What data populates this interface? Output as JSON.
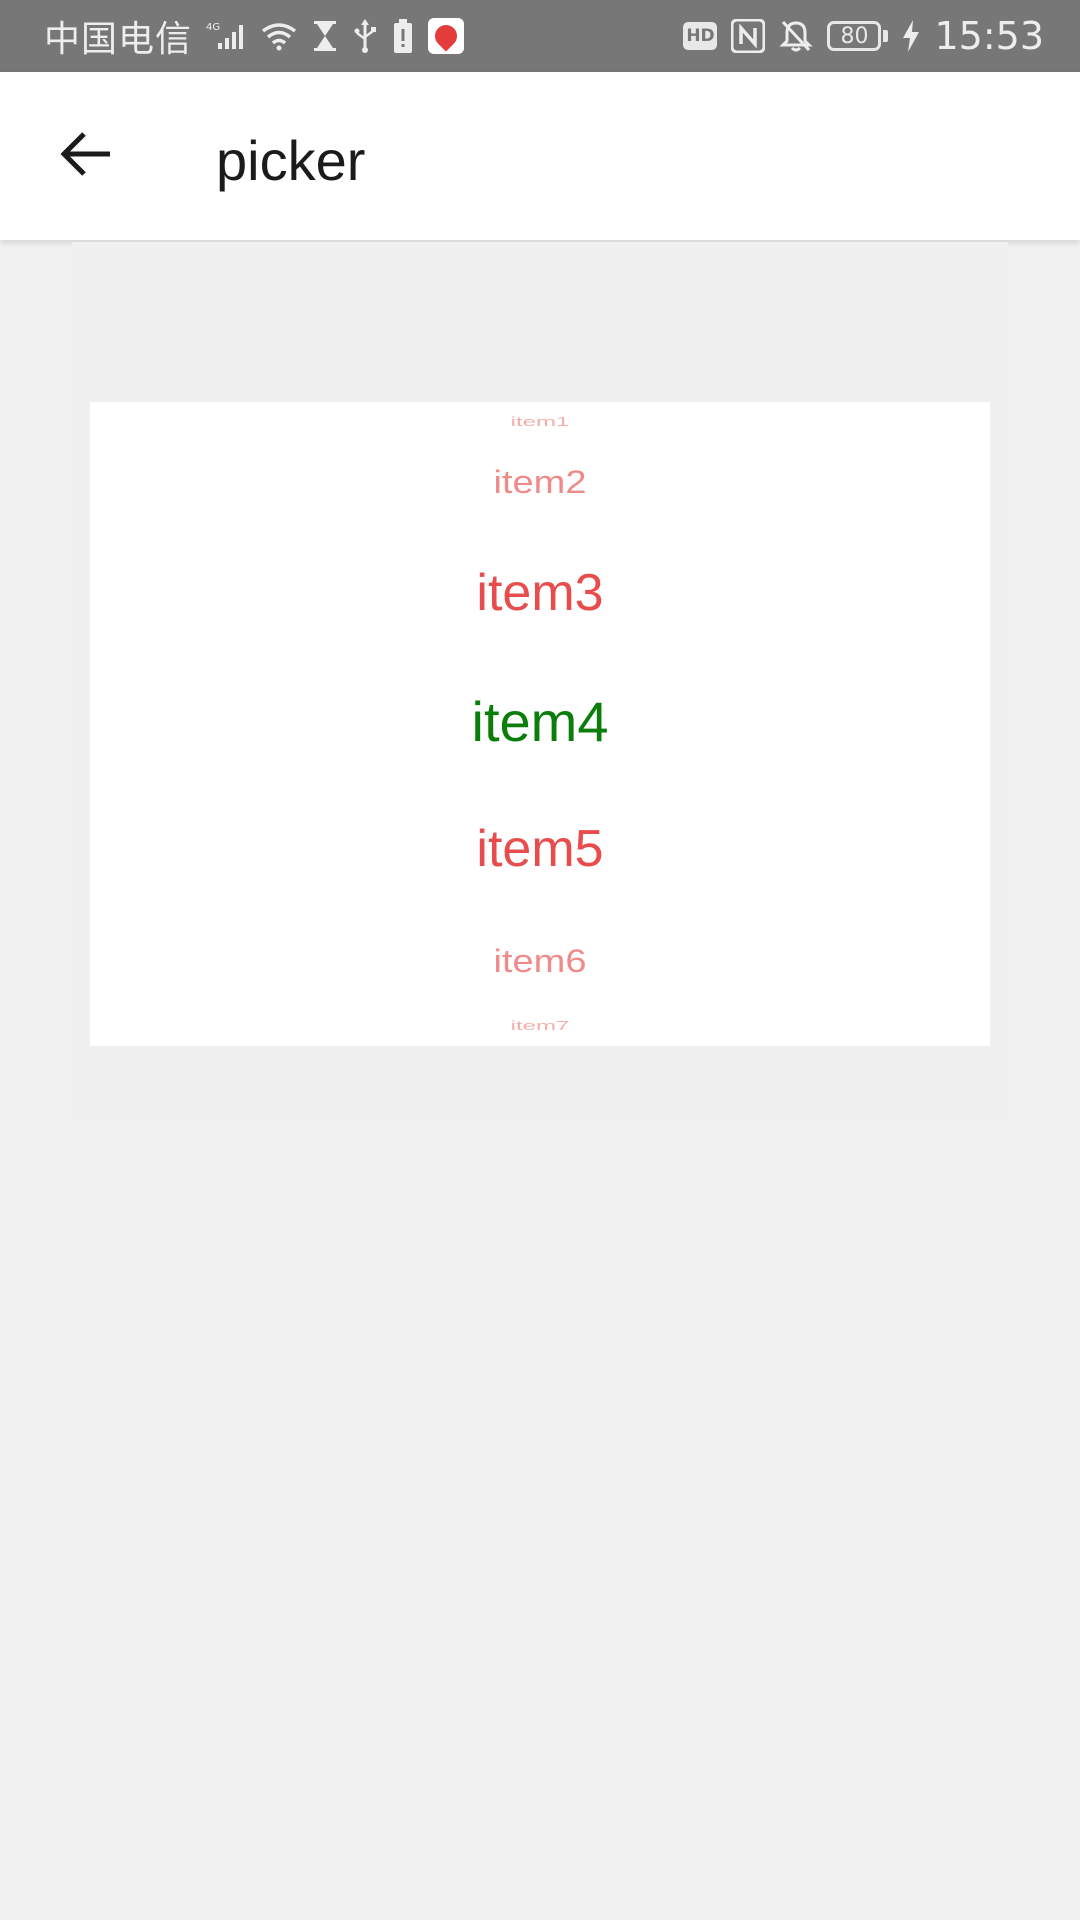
{
  "status_bar": {
    "carrier": "中国电信",
    "network": "4G",
    "time": "15:53",
    "battery_level": "80",
    "hd_badge": "HD",
    "icons": [
      "signal-icon",
      "wifi-icon",
      "hourglass-icon",
      "usb-icon",
      "battery-alert-icon",
      "map-app-icon",
      "hd-icon",
      "nfc-icon",
      "bell-off-icon",
      "battery-icon",
      "charging-icon"
    ]
  },
  "app_bar": {
    "title": "picker",
    "back_icon": "arrow-left-icon"
  },
  "picker": {
    "items": [
      "item1",
      "item2",
      "item3",
      "item4",
      "item5",
      "item6",
      "item7"
    ],
    "selected": "item4",
    "colors": {
      "selected": "#0b7d0b",
      "unselected": "#e84c4c"
    }
  }
}
